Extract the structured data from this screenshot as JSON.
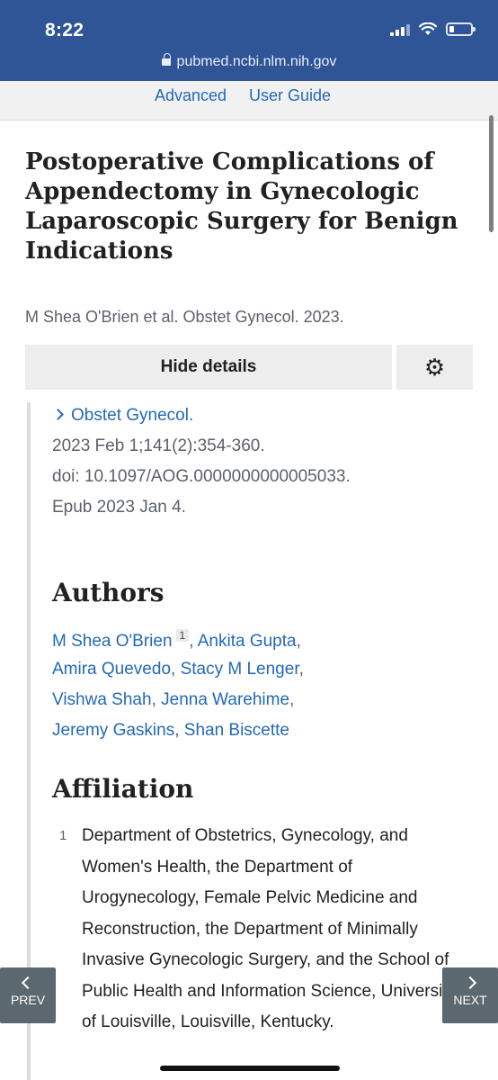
{
  "status_bar": {
    "time": "8:22"
  },
  "browser": {
    "url": "pubmed.ncbi.nlm.nih.gov"
  },
  "search_links": {
    "advanced": "Advanced",
    "user_guide": "User Guide"
  },
  "article": {
    "title": "Postoperative Complications of Appendectomy in Gynecologic Laparoscopic Surgery for Benign Indications",
    "citation": "M Shea O'Brien et al. Obstet Gynecol. 2023.",
    "hide_details_label": "Hide details",
    "journal": "Obstet Gynecol.",
    "pub_date": "2023 Feb 1;141(2):354-360.",
    "doi": "doi: 10.1097/AOG.0000000000005033.",
    "epub": "Epub 2023 Jan 4."
  },
  "authors": {
    "heading": "Authors",
    "list": [
      "M Shea O'Brien",
      "Ankita Gupta",
      "Amira Quevedo",
      "Stacy M Lenger",
      "Vishwa Shah",
      "Jenna Warehime",
      "Jeremy Gaskins",
      "Shan Biscette"
    ],
    "first_affiliation_ref": "1"
  },
  "affiliation": {
    "heading": "Affiliation",
    "number": "1",
    "text": "Department of Obstetrics, Gynecology, and Women's Health, the Department of Urogynecology, Female Pelvic Medicine and Reconstruction, the Department of Minimally Invasive Gynecologic Surgery, and the School of Public Health and Information Science, University of Louisville, Louisville, Kentucky."
  },
  "nav": {
    "prev_label": "PREV",
    "next_label": "NEXT"
  },
  "icons": {
    "gear": "gear-icon",
    "lock": "lock-icon",
    "chevron": "chevron-right-icon"
  },
  "colors": {
    "header_blue": "#2f5597",
    "link_blue": "#2369b7",
    "muted_text": "#5b616b"
  }
}
